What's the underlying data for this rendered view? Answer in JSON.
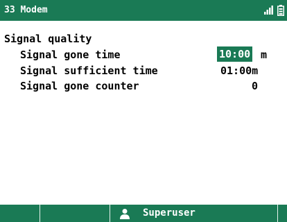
{
  "header": {
    "title": "33 Modem",
    "icons": [
      "signal-strength-icon",
      "battery-icon"
    ]
  },
  "section": {
    "title": "Signal quality",
    "rows": [
      {
        "label": "Signal gone time",
        "value": "10:00",
        "unit": "m",
        "selected": true
      },
      {
        "label": "Signal sufficient time",
        "value": "01:00m"
      },
      {
        "label": "Signal gone counter",
        "value": "0"
      }
    ]
  },
  "footer": {
    "user_label": "Superuser",
    "user_icon": "user-icon"
  },
  "colors": {
    "accent": "#1a7a55",
    "background": "#ffffff"
  }
}
